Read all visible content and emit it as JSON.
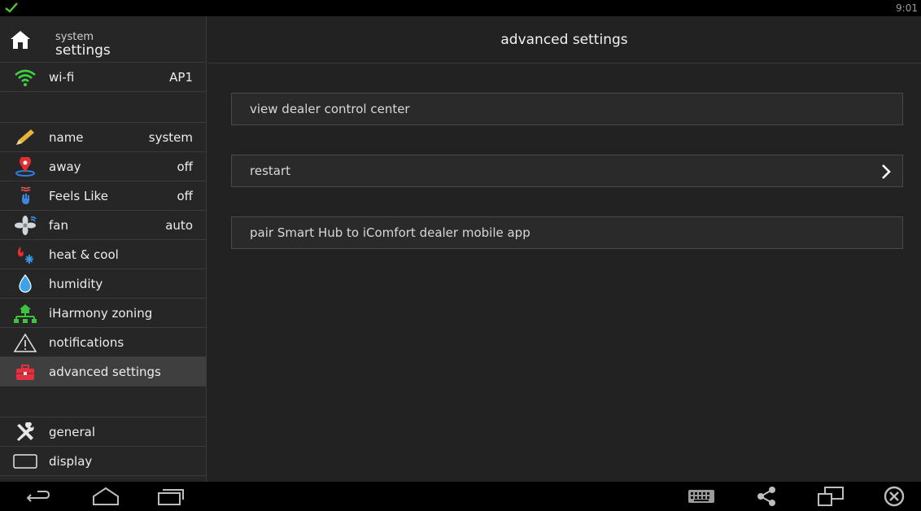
{
  "status_bar": {
    "time": "9:01",
    "check_icon": "check-icon",
    "check_color": "#5bc236"
  },
  "sidebar": {
    "header": {
      "small": "system",
      "big": "settings",
      "icon": "home-icon"
    },
    "wifi": {
      "label": "wi-fi",
      "value": "AP1",
      "icon": "wifi-icon",
      "color": "#3fd23f"
    },
    "items": [
      {
        "label": "name",
        "value": "system",
        "icon": "pencil-icon"
      },
      {
        "label": "away",
        "value": "off",
        "icon": "away-pin-icon"
      },
      {
        "label": "Feels Like",
        "value": "off",
        "icon": "feels-like-icon"
      },
      {
        "label": "fan",
        "value": "auto",
        "icon": "fan-icon"
      },
      {
        "label": "heat & cool",
        "value": "",
        "icon": "heat-cool-icon"
      },
      {
        "label": "humidity",
        "value": "",
        "icon": "humidity-drop-icon"
      },
      {
        "label": "iHarmony zoning",
        "value": "",
        "icon": "zoning-icon"
      },
      {
        "label": "notifications",
        "value": "",
        "icon": "warning-icon"
      },
      {
        "label": "advanced settings",
        "value": "",
        "icon": "toolbox-icon",
        "active": true
      }
    ],
    "bottom_items": [
      {
        "label": "general",
        "icon": "tools-icon"
      },
      {
        "label": "display",
        "icon": "display-icon"
      }
    ]
  },
  "main": {
    "title": "advanced settings",
    "buttons": [
      {
        "label": "view dealer control center",
        "has_chevron": false
      },
      {
        "label": "restart",
        "has_chevron": true
      },
      {
        "label": "pair Smart Hub to iComfort dealer mobile app",
        "has_chevron": false
      }
    ]
  },
  "nav_bar": {
    "icons": [
      "back-icon",
      "home-outline-icon",
      "recent-apps-icon",
      "keyboard-icon",
      "share-icon",
      "window-icon",
      "close-circle-icon"
    ]
  }
}
